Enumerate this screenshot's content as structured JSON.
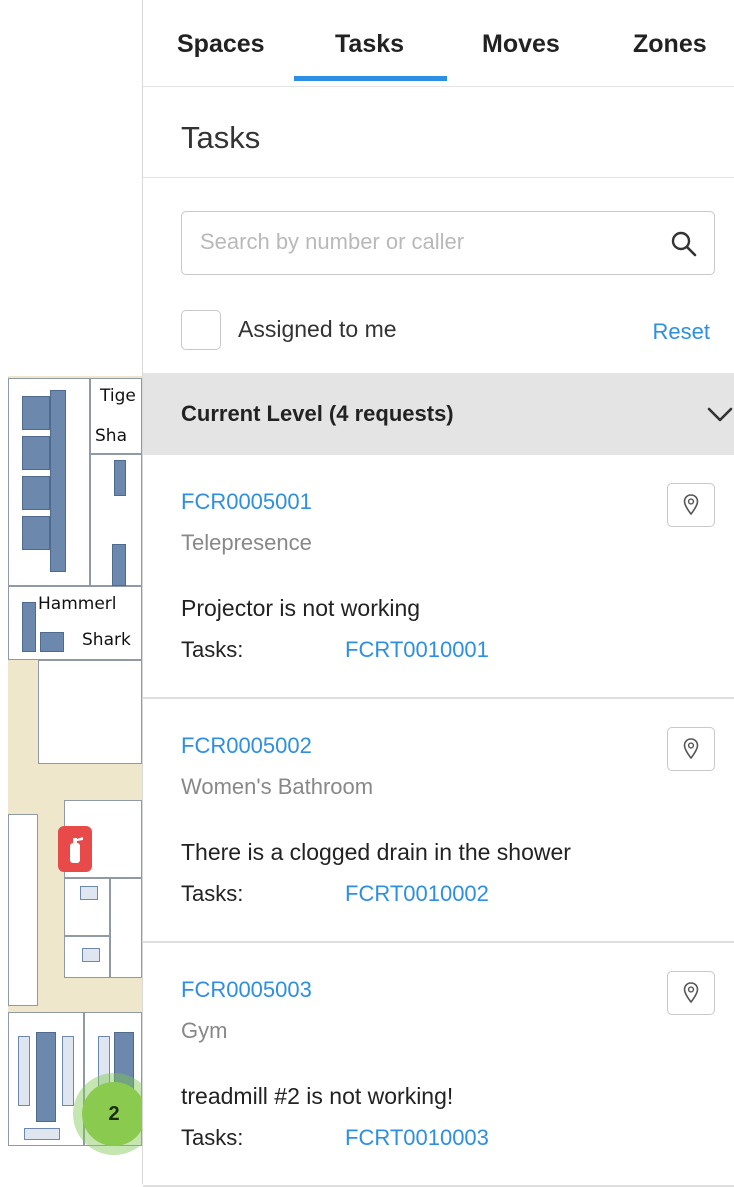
{
  "tabs": [
    {
      "label": "Spaces"
    },
    {
      "label": "Tasks",
      "active": true
    },
    {
      "label": "Moves"
    },
    {
      "label": "Zones"
    }
  ],
  "panel_title": "Tasks",
  "search": {
    "placeholder": "Search by number or caller",
    "value": ""
  },
  "filter": {
    "assigned_label": "Assigned to me",
    "assigned_checked": false,
    "reset_label": "Reset"
  },
  "group": {
    "title": "Current Level (4 requests)",
    "expanded": true
  },
  "requests": [
    {
      "id": "FCR0005001",
      "location": "Telepresence",
      "description": "Projector is not working",
      "tasks_label": "Tasks:",
      "task_id": "FCRT0010001"
    },
    {
      "id": "FCR0005002",
      "location": "Women's Bathroom",
      "description": "There is a clogged drain in the shower",
      "tasks_label": "Tasks:",
      "task_id": "FCRT0010002"
    },
    {
      "id": "FCR0005003",
      "location": "Gym",
      "description": "treadmill #2 is not working!",
      "tasks_label": "Tasks:",
      "task_id": "FCRT0010003"
    }
  ],
  "map": {
    "room_labels": [
      "Tige",
      "Sha",
      "Hammerl",
      "Shark"
    ],
    "cluster_count": "2"
  },
  "colors": {
    "accent": "#2d8fe3",
    "header_bg": "#e4e4e4",
    "extinguisher": "#e84a4a",
    "cluster": "#8acb4f"
  }
}
